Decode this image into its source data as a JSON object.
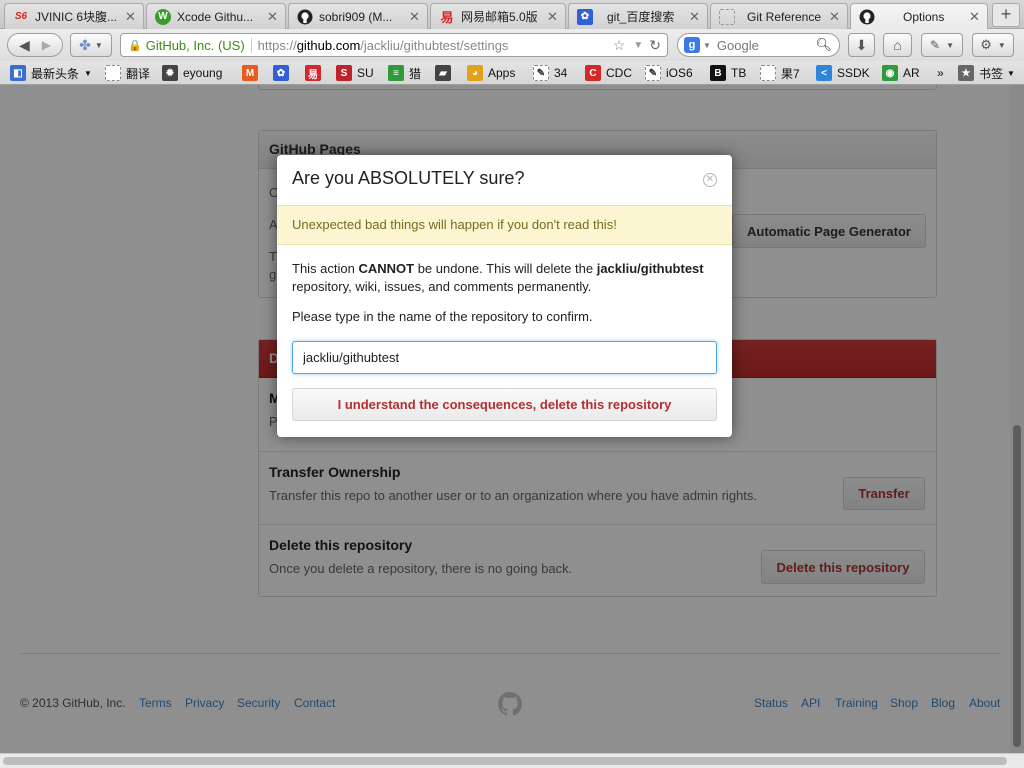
{
  "tabs": [
    {
      "title": "JVINIC 6块腹...",
      "icon": "s6-icon",
      "glyph": "S6",
      "color": "#d9241d",
      "text_color": "#d9241d"
    },
    {
      "title": "Xcode Githu...",
      "icon": "w-icon",
      "glyph": "W",
      "color": "#3a9b2c",
      "text_color": "#fff"
    },
    {
      "title": "sobri909 (M...",
      "icon": "github-icon",
      "glyph": "●",
      "color": "#222",
      "text_color": "#fff"
    },
    {
      "title": "网易邮箱5.0版",
      "icon": "netease-icon",
      "glyph": "易",
      "color": "#d5262d",
      "text_color": "#fff"
    },
    {
      "title": "git_百度搜索",
      "icon": "baidu-paw-icon",
      "glyph": "✿",
      "color": "#2f60d8",
      "text_color": "#fff"
    },
    {
      "title": "Git Reference",
      "icon": "blank-page-icon",
      "glyph": "",
      "color": "#f0f0f0",
      "text_color": "#999"
    },
    {
      "title": "Options",
      "icon": "github-icon",
      "glyph": "●",
      "color": "#222",
      "text_color": "#fff"
    }
  ],
  "nav": {
    "url_org": "GitHub, Inc. (US)",
    "url_proto": "https://",
    "url_host": "github.com",
    "url_path": "/jackliu/githubtest/settings",
    "search_placeholder": "Google"
  },
  "bookmarks": [
    {
      "label": "最新头条",
      "icon": "rss-icon",
      "color": "#3b6fcf",
      "glyph": "◧",
      "dropdown": true
    },
    {
      "label": "翻译",
      "icon": "blank-page-icon",
      "color": "#fff",
      "glyph": ""
    },
    {
      "label": "eyoung",
      "icon": "gear-icon",
      "color": "#444",
      "glyph": "✹"
    },
    {
      "label": "",
      "icon": "magento-icon",
      "color": "#e85b1f",
      "glyph": "M"
    },
    {
      "label": "",
      "icon": "baidu-paw-icon",
      "color": "#2f60d8",
      "glyph": "✿"
    },
    {
      "label": "",
      "icon": "netease-icon",
      "color": "#d5262d",
      "glyph": "易"
    },
    {
      "label": "SU",
      "icon": "s-icon",
      "color": "#c0222a",
      "glyph": "S"
    },
    {
      "label": "猎",
      "icon": "bookmark-green-icon",
      "color": "#2e9a3a",
      "glyph": "≡"
    },
    {
      "label": "",
      "icon": "book-icon",
      "color": "#444",
      "glyph": "▰"
    },
    {
      "label": "Apps",
      "icon": "apps-icon",
      "color": "#e0a21b",
      "glyph": "◕"
    },
    {
      "label": "34",
      "icon": "script-icon",
      "color": "#fff",
      "glyph": "✎"
    },
    {
      "label": "CDC",
      "icon": "c-icon",
      "color": "#d72828",
      "glyph": "C"
    },
    {
      "label": "iOS6",
      "icon": "script-icon",
      "color": "#fff",
      "glyph": "✎"
    },
    {
      "label": "TB",
      "icon": "b-icon",
      "color": "#111",
      "glyph": "B"
    },
    {
      "label": "果7",
      "icon": "blank-page-icon",
      "color": "#fff",
      "glyph": ""
    },
    {
      "label": "SSDK",
      "icon": "share-icon",
      "color": "#2f86d8",
      "glyph": "<"
    },
    {
      "label": "AR",
      "icon": "eye-icon",
      "color": "#2e9a3a",
      "glyph": "◉"
    }
  ],
  "bookmarks_more": "»",
  "bookmarks_menu": "书签",
  "pages": {
    "header": "GitHub Pages",
    "gen_button": "Automatic Page Generator",
    "stub_lines": [
      "O",
      "A",
      "T",
      "g"
    ]
  },
  "danger": {
    "header": "D",
    "rows": [
      {
        "title": "M",
        "desc": "P",
        "button": ""
      },
      {
        "title": "Transfer Ownership",
        "desc": "Transfer this repo to another user or to an organization where you have admin rights.",
        "button": "Transfer"
      },
      {
        "title": "Delete this repository",
        "desc": "Once you delete a repository, there is no going back.",
        "button": "Delete this repository"
      }
    ]
  },
  "modal": {
    "title": "Are you ABSOLUTELY sure?",
    "warning": "Unexpected bad things will happen if you don't read this!",
    "body_prefix": "This action ",
    "body_strong": "CANNOT",
    "body_mid": " be undone. This will delete the ",
    "body_repo": "jackliu/githubtest",
    "body_suffix": " repository, wiki, issues, and comments permanently.",
    "confirm_prompt": "Please type in the name of the repository to confirm.",
    "input_value": "jackliu/githubtest",
    "confirm_button": "I understand the consequences, delete this repository"
  },
  "footer": {
    "copyright": "© 2013 GitHub, Inc.",
    "left_links": [
      "Terms",
      "Privacy",
      "Security",
      "Contact"
    ],
    "right_links": [
      "Status",
      "API",
      "Training",
      "Shop",
      "Blog",
      "About"
    ]
  },
  "colors": {
    "accent_link": "#4183c4",
    "danger_red": "#bd2c2c",
    "warning_bg": "#fbf5d2",
    "focus_blue": "#51a7e8"
  }
}
